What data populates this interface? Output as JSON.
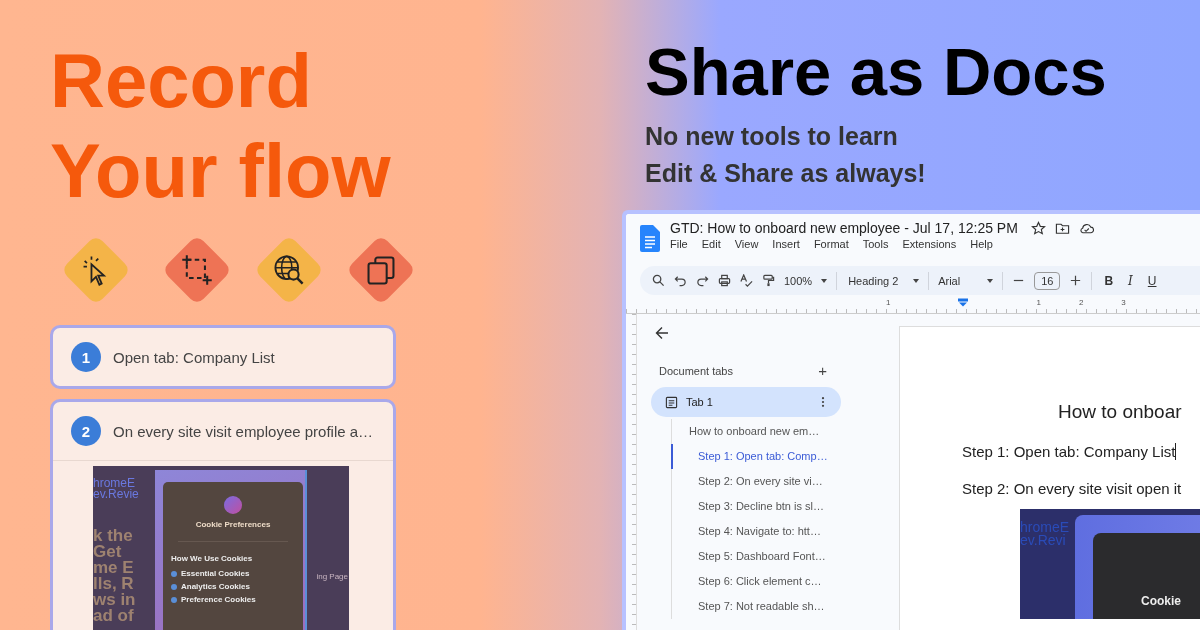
{
  "promo": {
    "headline": [
      "Record",
      "Your flow"
    ],
    "tools": [
      {
        "kind": "click",
        "color": "#f4b448"
      },
      {
        "kind": "capture",
        "color": "#ee7355"
      },
      {
        "kind": "web-search",
        "color": "#f4b448"
      },
      {
        "kind": "copy",
        "color": "#ee7355"
      }
    ]
  },
  "steps": [
    {
      "number": "1",
      "text": "Open tab: Company List"
    },
    {
      "number": "2",
      "text": "On every site visit employee profile a…",
      "screenshot": {
        "page_fragments": [
          "hromeE",
          "ev.Revie"
        ],
        "headline_fragments": [
          "k the",
          "Get",
          "me E",
          "lls, R",
          "ws in",
          "ad of"
        ],
        "side_label": "ing Page",
        "dialog": {
          "title": "Cookie Preferences",
          "section": "How We Use Cookies",
          "items": [
            "Essential Cookies",
            "Analytics Cookies",
            "Preference Cookies"
          ]
        }
      }
    }
  ],
  "share": {
    "headline": "Share as Docs",
    "subtitle": [
      "No new tools to learn",
      "Edit & Share as always!"
    ]
  },
  "docs": {
    "title": "GTD: How to onboard new employee - Jul 17, 12:25 PM",
    "menu": [
      "File",
      "Edit",
      "View",
      "Insert",
      "Format",
      "Tools",
      "Extensions",
      "Help"
    ],
    "toolbar": {
      "zoom": "100%",
      "style": "Heading 2",
      "font": "Arial",
      "size": "16",
      "format_buttons": [
        "B",
        "I",
        "U"
      ]
    },
    "ruler": [
      "1",
      "1",
      "2",
      "3"
    ],
    "sidebar": {
      "heading": "Document tabs",
      "add": "+",
      "tabs": [
        {
          "label": "Tab 1",
          "selected": true
        }
      ],
      "outline": [
        {
          "text": "How to onboard new em…",
          "selected": false,
          "children": [
            {
              "text": "Step 1: Open tab: Comp…",
              "selected": true
            },
            {
              "text": "Step 2: On every site vi…",
              "selected": false
            },
            {
              "text": "Step 3: Decline btn is sl…",
              "selected": false
            },
            {
              "text": "Step 4: Navigate to: htt…",
              "selected": false
            },
            {
              "text": "Step 5: Dashboard Font…",
              "selected": false
            },
            {
              "text": "Step 6: Click element c…",
              "selected": false
            },
            {
              "text": "Step 7: Not readable sh…",
              "selected": false
            }
          ]
        }
      ]
    },
    "page": {
      "title": "How to onboar",
      "paragraphs": [
        "Step 1: Open tab: Company List",
        "Step 2: On every site visit open it"
      ],
      "screenshot": {
        "page_fragments": [
          "hromeE",
          "ev.Revi"
        ],
        "dialog_title": "Cookie"
      }
    }
  }
}
